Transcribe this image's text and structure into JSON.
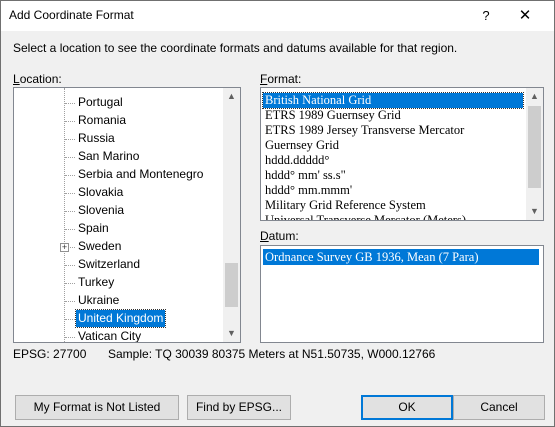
{
  "window": {
    "title": "Add Coordinate Format",
    "help_label": "?",
    "close_label": "✕"
  },
  "instruction": "Select a location to see the coordinate formats and datums available for that region.",
  "location": {
    "label_u": "L",
    "label_rest": "ocation:",
    "items": [
      {
        "label": "Portugal"
      },
      {
        "label": "Romania"
      },
      {
        "label": "Russia"
      },
      {
        "label": "San Marino"
      },
      {
        "label": "Serbia and Montenegro"
      },
      {
        "label": "Slovakia"
      },
      {
        "label": "Slovenia"
      },
      {
        "label": "Spain"
      },
      {
        "label": "Sweden",
        "expandable": true
      },
      {
        "label": "Switzerland"
      },
      {
        "label": "Turkey"
      },
      {
        "label": "Ukraine"
      },
      {
        "label": "United Kingdom",
        "selected": true
      },
      {
        "label": "Vatican City"
      }
    ]
  },
  "format": {
    "label_u": "F",
    "label_rest": "ormat:",
    "items": [
      {
        "label": "British National Grid",
        "selected": true
      },
      {
        "label": "ETRS 1989 Guernsey Grid"
      },
      {
        "label": "ETRS 1989 Jersey Transverse Mercator"
      },
      {
        "label": "Guernsey Grid"
      },
      {
        "label": "hddd.ddddd°"
      },
      {
        "label": "hddd° mm' ss.s\""
      },
      {
        "label": "hddd° mm.mmm'"
      },
      {
        "label": "Military Grid Reference System"
      },
      {
        "label": "Universal Transverse Mercator (Meters)"
      }
    ]
  },
  "datum": {
    "label_u": "D",
    "label_rest": "atum:",
    "items": [
      {
        "label": "Ordnance Survey GB 1936, Mean (7 Para)",
        "selected": true
      }
    ]
  },
  "status": {
    "epsg": "EPSG: 27700",
    "sample": "Sample: TQ 30039 80375 Meters at N51.50735, W000.12766"
  },
  "buttons": {
    "not_listed": "My Format is Not Listed",
    "find_epsg": "Find by EPSG...",
    "ok": "OK",
    "cancel": "Cancel"
  },
  "icons": {
    "scroll_up": "▲",
    "scroll_down": "▼",
    "expand": "+"
  },
  "colors": {
    "selection": "#0078d7",
    "dialog_bg": "#f0f0f0"
  }
}
